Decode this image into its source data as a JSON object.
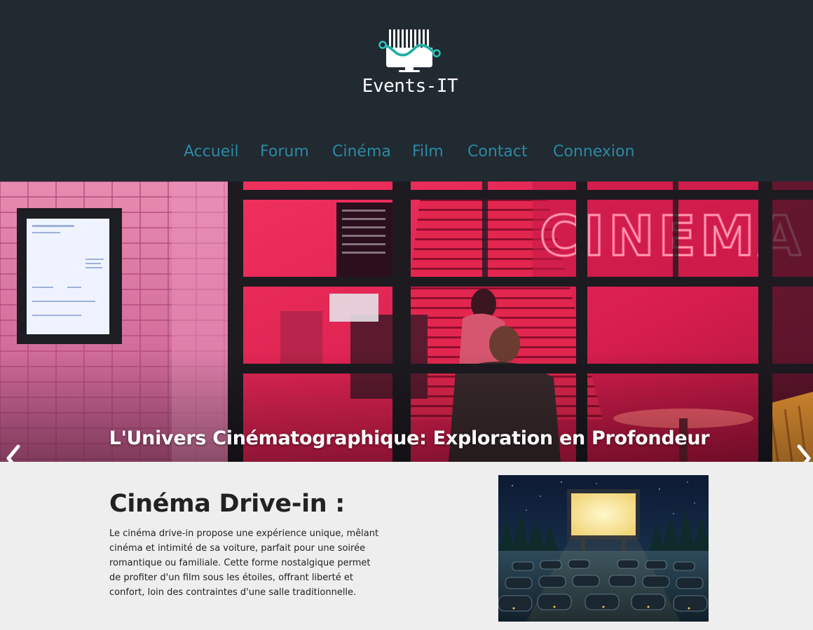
{
  "header": {
    "logo_text": "Events-IT",
    "nav": [
      {
        "label": "Accueil"
      },
      {
        "label": "Forum"
      },
      {
        "label": "Cinéma"
      },
      {
        "label": "Film"
      },
      {
        "label": "Contact"
      },
      {
        "label": "Connexion"
      }
    ]
  },
  "hero": {
    "caption": "L'Univers Cinématographique: Exploration en Profondeur",
    "sign_text": "CINEMA",
    "prev_icon": "chevron-left-icon",
    "next_icon": "chevron-right-icon"
  },
  "section": {
    "title": "Cinéma Drive-in :",
    "text": "Le cinéma drive-in propose une expérience unique, mêlant cinéma et intimité de sa voiture, parfait pour une soirée romantique ou familiale. Cette forme nostalgique permet de profiter d'un film sous les étoiles, offrant liberté et confort, loin des contraintes d'une salle traditionnelle."
  },
  "colors": {
    "header_bg": "#212931",
    "nav_link": "#2a8aa2",
    "page_bg": "#eeeeee",
    "logo_accent": "#2bc3b8",
    "neon": "#ff4f7a"
  }
}
